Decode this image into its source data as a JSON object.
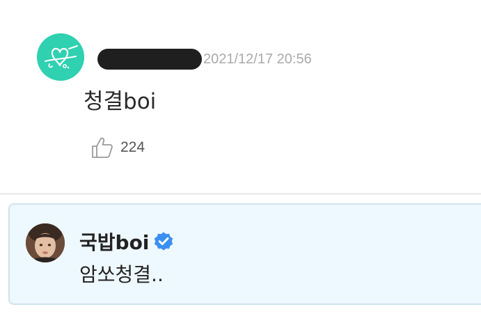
{
  "comment": {
    "author_redacted": true,
    "timestamp": "2021/12/17 20:56",
    "text": "청결boi",
    "likes": "224",
    "icons": {
      "avatar": "heart-doodle-avatar",
      "like": "thumbs-up-icon"
    }
  },
  "reply": {
    "author": "국밥boi",
    "verified": true,
    "text": "암쏘청결..",
    "icons": {
      "avatar": "profile-photo-avatar",
      "verified": "verified-badge-icon"
    }
  },
  "colors": {
    "avatar_teal": "#2fd1b1",
    "timestamp_gray": "#a9a9a9",
    "reply_bg": "#eef8ff",
    "reply_border": "#cfe2ee",
    "verified_blue": "#3b8ff0"
  }
}
